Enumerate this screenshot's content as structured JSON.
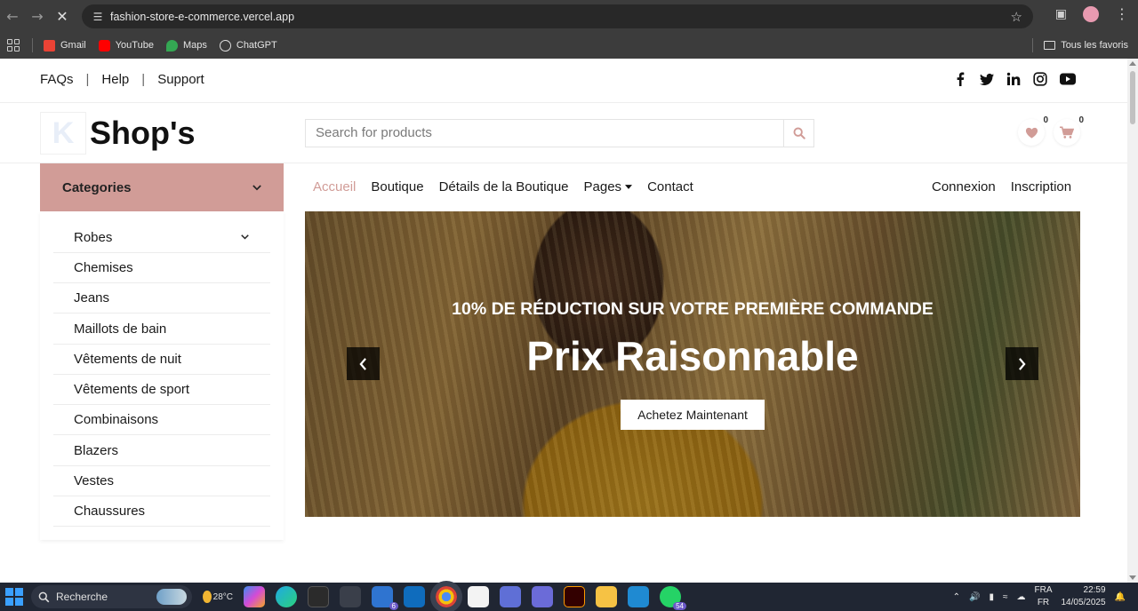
{
  "browser": {
    "url": "fashion-store-e-commerce.vercel.app",
    "bookmarks": [
      "Gmail",
      "YouTube",
      "Maps",
      "ChatGPT"
    ],
    "favorites_label": "Tous les favoris"
  },
  "topbar": {
    "links": [
      "FAQs",
      "Help",
      "Support"
    ],
    "separator": "|",
    "social_icons": [
      "facebook-icon",
      "twitter-icon",
      "linkedin-icon",
      "instagram-icon",
      "youtube-icon"
    ]
  },
  "header": {
    "logo_letter": "K",
    "logo_text": "Shop's",
    "search_placeholder": "Search for products",
    "wishlist_count": "0",
    "cart_count": "0"
  },
  "sidebar": {
    "title": "Categories",
    "items": [
      "Robes",
      "Chemises",
      "Jeans",
      "Maillots de bain",
      "Vêtements de nuit",
      "Vêtements de sport",
      "Combinaisons",
      "Blazers",
      "Vestes",
      "Chaussures"
    ]
  },
  "nav": {
    "items": [
      "Accueil",
      "Boutique",
      "Détails de la Boutique",
      "Pages",
      "Contact"
    ],
    "active": "Accueil",
    "right": [
      "Connexion",
      "Inscription"
    ]
  },
  "hero": {
    "subtitle": "10% DE RÉDUCTION SUR VOTRE PREMIÈRE COMMANDE",
    "title": "Prix Raisonnable",
    "cta": "Achetez Maintenant"
  },
  "taskbar": {
    "search_label": "Recherche",
    "weather": "28°C",
    "badges": [
      "6",
      "54"
    ],
    "lang_top": "FRA",
    "lang_bottom": "FR",
    "time": "22:59",
    "date": "14/05/2025"
  },
  "colors": {
    "accent": "#d19c97",
    "chrome_bg": "#3c3c3c",
    "taskbar_bg": "#202633"
  }
}
